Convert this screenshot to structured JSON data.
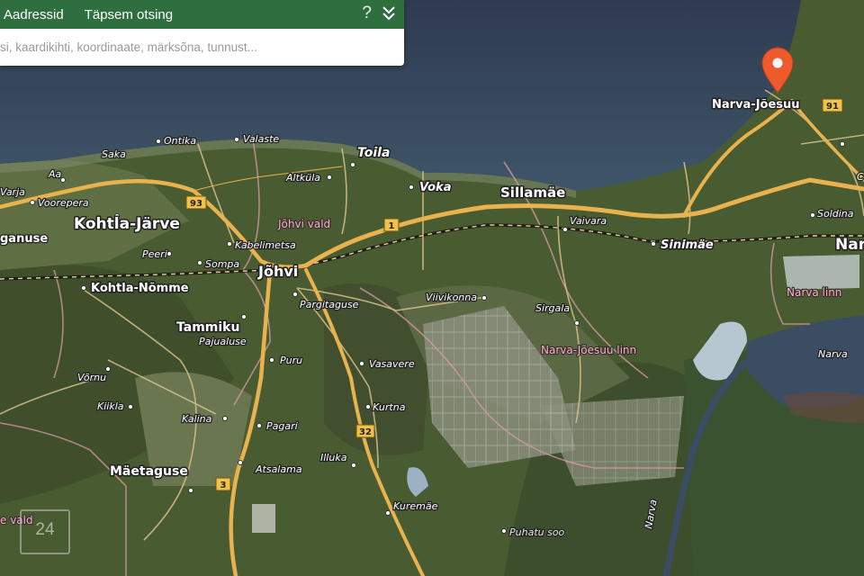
{
  "panel": {
    "tab_address": "Aadressid",
    "tab_search": "Täpsem otsing",
    "help": "?",
    "search_placeholder": "si, kaardikihti, koordinaate, märksõna, tunnust..."
  },
  "map": {
    "places": {
      "kohtla_jarve": "Kohtla-Järve",
      "johvi": "Jõhvi",
      "sillamae": "Sillamäe",
      "narva_joesuu": "Narva-Jõesuu",
      "narva_edge": "Nar",
      "maetaguse": "Mäetaguse",
      "tammiku": "Tammiku",
      "kohtla_nomme": "Kohtla-Nõmme",
      "toila": "Toila",
      "voka": "Voka",
      "sinimae": "Sinimäe",
      "aa": "Aa",
      "saka": "Saka",
      "ontika": "Ontika",
      "valaste": "Valaste",
      "voorepera": "Voorepera",
      "varja": "Varja",
      "ganuse": "ganuse",
      "peeri": "Peeri",
      "kabelimetsa": "Kabelimetsa",
      "sompa": "Sompa",
      "altkula": "Altküla",
      "vaivara": "Vaivara",
      "soldina": "Soldina",
      "pargitaguse": "Pargitaguse",
      "viivikonna": "Viivikonna",
      "sirgala": "Sirgala",
      "pajualuse": "Pajualuse",
      "puru": "Puru",
      "vasavere": "Vasavere",
      "kurtna": "Kurtna",
      "vorru": "Võrnu",
      "kiikla": "Kiikla",
      "kalina": "Kalina",
      "pagari": "Pagari",
      "atsalama": "Atsalama",
      "illuka": "Illuka",
      "kuremae": "Kuremäe",
      "puhatu_soo": "Puhatu soo",
      "narva_river": "Narva",
      "narva_east": "Narva",
      "c_edge": "C"
    },
    "regions": {
      "johvi_vald": "Jõhvi vald",
      "narva_joesuu_linn": "Narva-Jõesuu linn",
      "narva_linn": "Narva linn",
      "e_valo": "e vald"
    },
    "roads": {
      "r93": "93",
      "r1": "1",
      "r3": "3",
      "r32": "32",
      "r91": "91"
    },
    "clock_text": "24",
    "colors": {
      "sea": "#36455c",
      "land": "#4a5d32",
      "road": "#e8b24f",
      "marker": "#ef5a2c",
      "panel_header": "#2f6e3f"
    },
    "marker_icon": "map-pin-icon"
  }
}
